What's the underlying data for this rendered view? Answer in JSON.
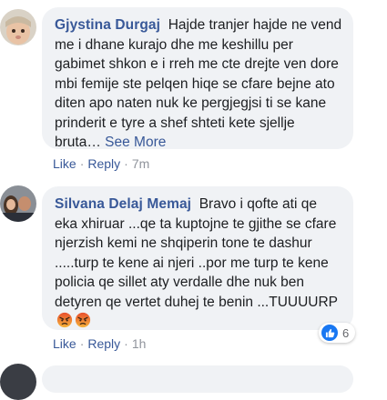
{
  "comments": [
    {
      "author": "Gjystina Durgaj",
      "text": "Hajde tranjer hajde ne vend me i dhane kurajo dhe me keshillu per gabimet shkon e i rreh me cte drejte ven dore mbi femije ste pelqen hiqe se cfare bejne ato diten apo naten nuk ke pergjegjsi ti se kane prinderit e tyre a shef shteti kete sjellje bruta…",
      "see_more": "See More",
      "like": "Like",
      "reply": "Reply",
      "time": "7m"
    },
    {
      "author": "Silvana Delaj Memaj",
      "text": "Bravo i qofte ati qe eka xhiruar ...qe ta kuptojne te gjithe se cfare njerzish kemi ne shqiperin tone te dashur .....turp te kene ai njeri ..por me turp te kene policia qe sillet aty verdalle dhe nuk ben detyren qe vertet duhej te benin ...TUUUURP",
      "emojis": [
        "angry-face-icon",
        "angry-face-icon"
      ],
      "reaction_count": "6",
      "like": "Like",
      "reply": "Reply",
      "time": "1h"
    }
  ],
  "colors": {
    "author": "#385898",
    "bubble": "#f0f2f5",
    "like_badge": "#1877f2",
    "angry": "#f0832f"
  }
}
